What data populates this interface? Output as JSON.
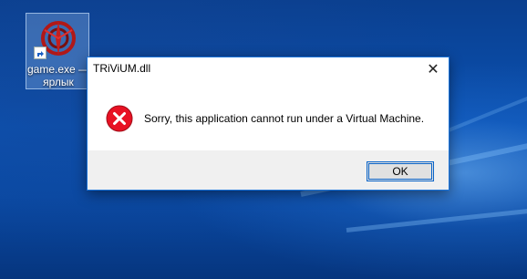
{
  "desktop": {
    "icon": {
      "name": "game-exe-shortcut",
      "label_line1": "game.exe —",
      "label_line2": "ярлык",
      "icon_name": "game-logo-icon",
      "badge_icon": "shortcut-arrow-icon"
    }
  },
  "dialog": {
    "title": "TRiViUM.dll",
    "close_label": "✕",
    "icon_name": "error-icon",
    "message": "Sorry, this application cannot run under a Virtual Machine.",
    "ok_label": "OK"
  },
  "colors": {
    "accent": "#0078d7",
    "error_red": "#e81123",
    "desktop_blue": "#0b52b3"
  }
}
